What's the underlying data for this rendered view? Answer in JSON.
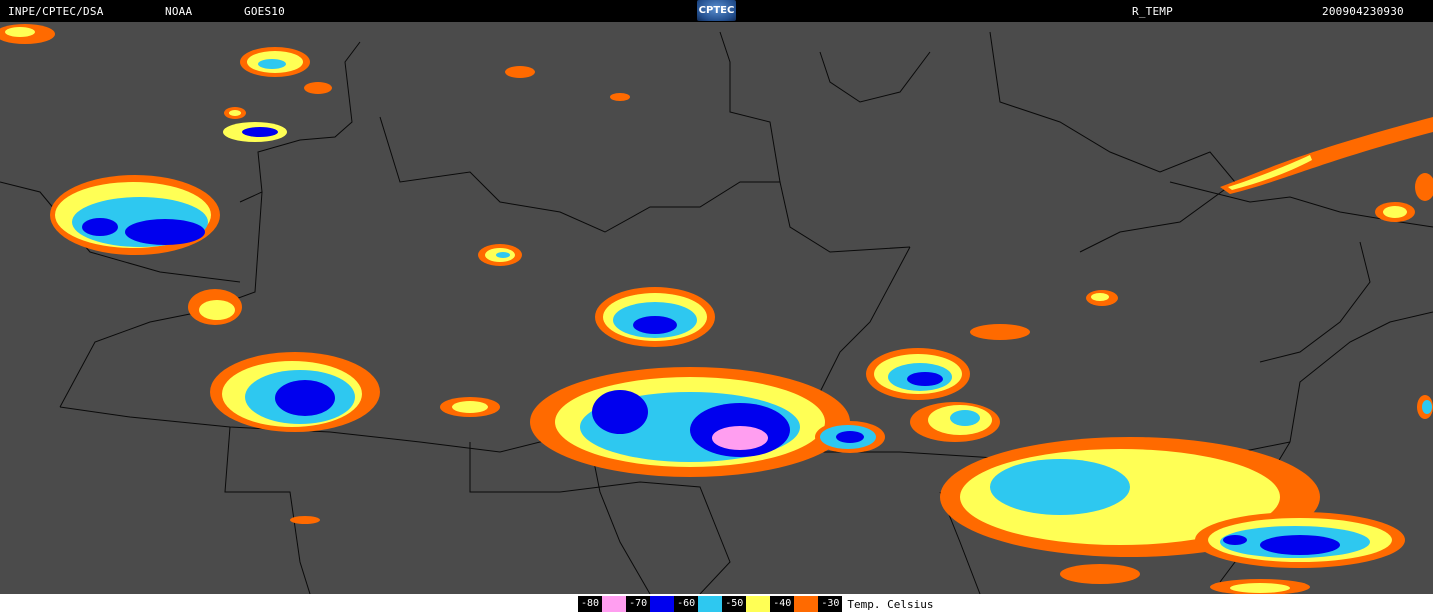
{
  "header": {
    "source": "INPE/CPTEC/DSA",
    "agency": "NOAA",
    "satellite": "GOES10",
    "logo_text": "CPTEC",
    "product": "R_TEMP",
    "timestamp": "200904230930"
  },
  "legend": {
    "items": [
      {
        "label": "-80",
        "color": "#ff9ef0"
      },
      {
        "label": "-70",
        "color": "#0000ee"
      },
      {
        "label": "-60",
        "color": "#2ec8f0"
      },
      {
        "label": "-50",
        "color": "#ffff55"
      },
      {
        "label": "-40",
        "color": "#ff6a00"
      },
      {
        "label": "-30",
        "color": null
      }
    ],
    "unit_label": "Temp. Celsius"
  },
  "colors": {
    "background": "#000000",
    "cloud_base": "#6a6a6a",
    "border_lines": "#000000"
  }
}
